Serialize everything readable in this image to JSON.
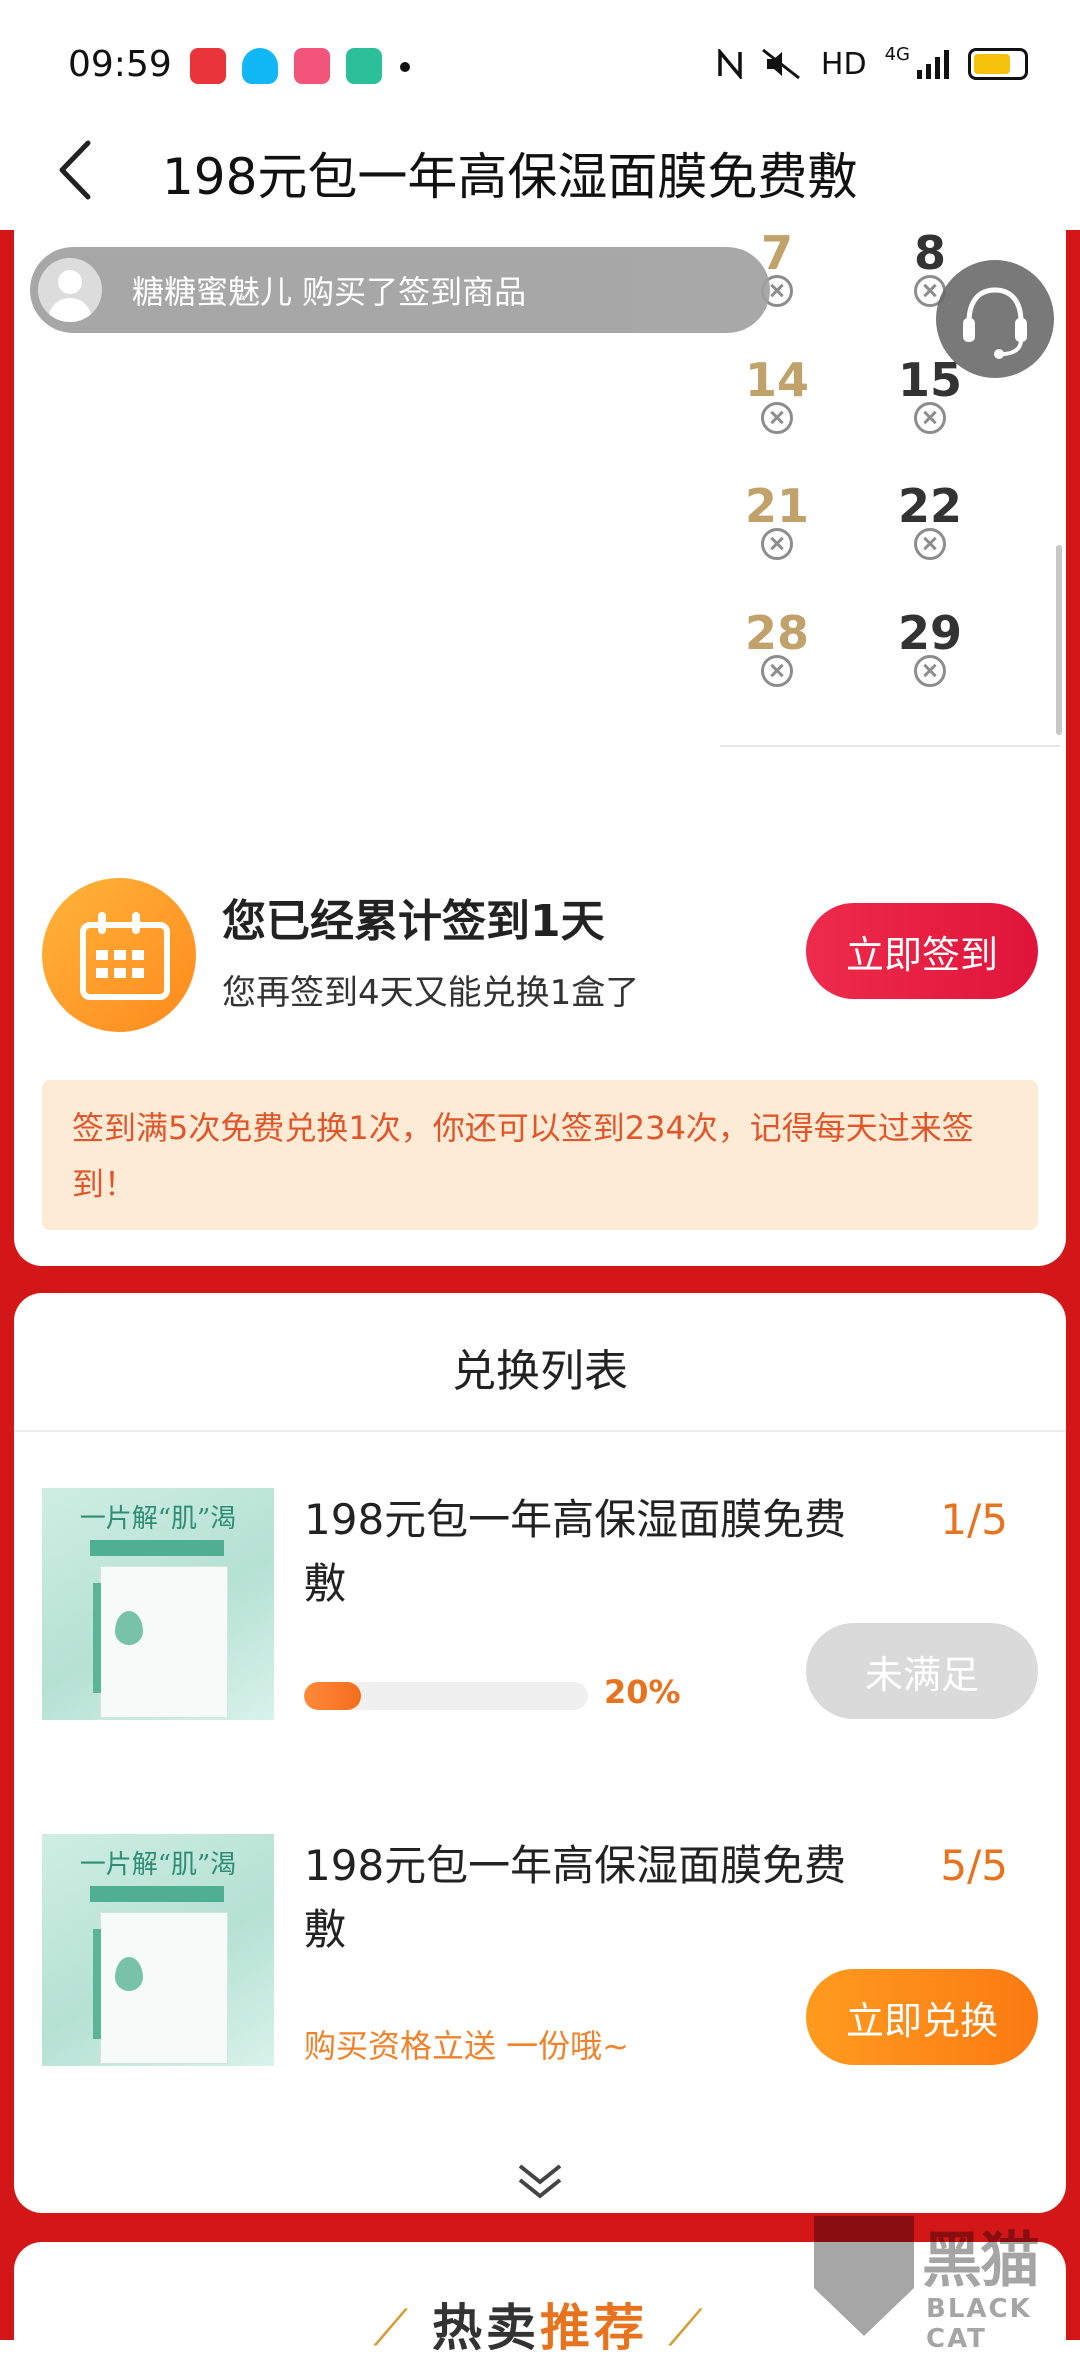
{
  "status_bar": {
    "time": "09:59",
    "network": "HD",
    "signal_label": "4G",
    "icons": [
      "app-icon-red",
      "qq-icon",
      "video-app-icon",
      "gallery-app-icon",
      "notification-dot",
      "nfc-icon",
      "mute-icon",
      "signal-icon",
      "battery-icon"
    ]
  },
  "nav": {
    "title": "198元包一年高保湿面膜免费敷",
    "back_icon": "chevron-left-icon"
  },
  "toast": {
    "text": "糖糖蜜魅儿 购买了签到商品"
  },
  "calendar": {
    "days": [
      {
        "num": "7",
        "style": "gold"
      },
      {
        "num": "8",
        "style": "gray"
      },
      {
        "num": "14",
        "style": "gold"
      },
      {
        "num": "15",
        "style": "gray"
      },
      {
        "num": "21",
        "style": "gold"
      },
      {
        "num": "22",
        "style": "gray"
      },
      {
        "num": "28",
        "style": "gold"
      },
      {
        "num": "29",
        "style": "gray"
      }
    ],
    "missed_icon": "circle-x-icon"
  },
  "support": {
    "icon": "headset-icon"
  },
  "checkin": {
    "title": "您已经累计签到1天",
    "subtitle": "您再签到4天又能兑换1盒了",
    "button": "立即签到",
    "icon": "calendar-icon"
  },
  "notice": {
    "text": "签到满5次免费兑换1次，你还可以签到234次，记得每天过来签到！"
  },
  "exchange": {
    "title": "兑换列表",
    "items": [
      {
        "image_text": "一片解“肌”渴",
        "name": "198元包一年高保湿面膜免费敷",
        "count": "1/5",
        "progress": 0.2,
        "progress_label": "20%",
        "button": "未满足"
      },
      {
        "image_text": "一片解“肌”渴",
        "name": "198元包一年高保湿面膜免费敷",
        "count": "5/5",
        "gift_text": "购买资格立送 一份哦~",
        "button": "立即兑换"
      }
    ],
    "more_icon": "double-chevron-down-icon"
  },
  "hot": {
    "title_part1": "热卖",
    "title_part2": "推荐"
  },
  "watermark": {
    "big": "黑猫",
    "small": "BLACK CAT"
  },
  "colors": {
    "brand_red": "#d31618",
    "accent_orange": "#e8731e",
    "button_pink": "#e0143a",
    "notice_bg": "#fdebd5",
    "gold_day": "#c0a26a"
  }
}
